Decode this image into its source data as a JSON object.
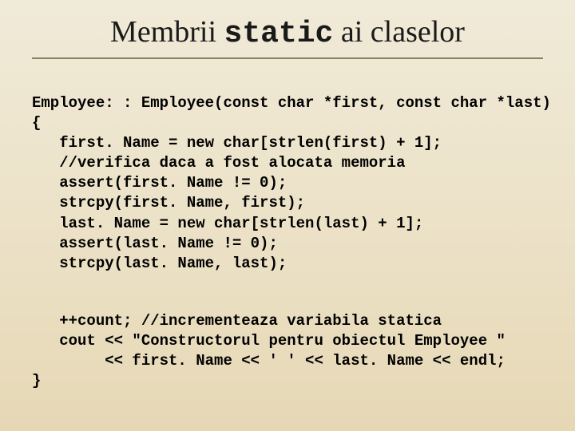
{
  "title": {
    "part1": "Membrii ",
    "mono": "static",
    "part2": " ai claselor"
  },
  "code": {
    "l1": "Employee: : Employee(const char *first, const char *last)",
    "l2": "{",
    "l3": "   first. Name = new char[strlen(first) + 1];",
    "l4": "   //verifica daca a fost alocata memoria",
    "l5": "   assert(first. Name != 0);",
    "l6": "   strcpy(first. Name, first);",
    "l7": "   last. Name = new char[strlen(last) + 1];",
    "l8": "   assert(last. Name != 0);",
    "l9": "   strcpy(last. Name, last);",
    "l10": "   ++count; //incrementeaza variabila statica",
    "l11": "   cout << \"Constructorul pentru obiectul Employee \"",
    "l12": "        << first. Name << ' ' << last. Name << endl;",
    "l13": "}"
  }
}
